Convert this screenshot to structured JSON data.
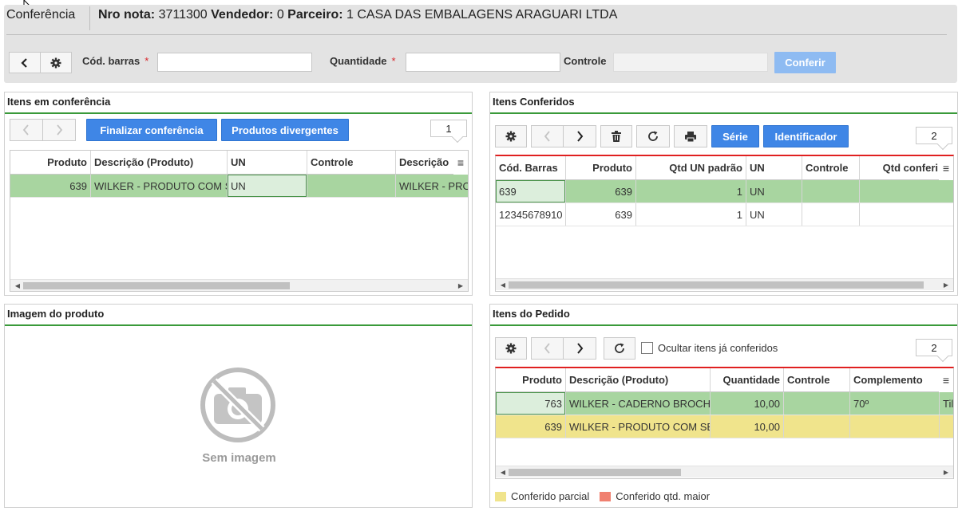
{
  "header": {
    "title": "Conferência",
    "nro_nota_label": "Nro nota:",
    "nro_nota_value": "3711300",
    "vendedor_label": "Vendedor:",
    "vendedor_value": "0",
    "parceiro_label": "Parceiro:",
    "parceiro_value": "1 CASA DAS EMBALAGENS ARAGUARI LTDA"
  },
  "toolbar": {
    "cod_barras_label": "Cód. barras",
    "quantidade_label": "Quantidade",
    "controle_label": "Controle",
    "required_mark": "*",
    "conferir_label": "Conferir",
    "cod_barras_value": "",
    "quantidade_value": "",
    "controle_value": ""
  },
  "itens_conferencia": {
    "title": "Itens em conferência",
    "finalizar_label": "Finalizar conferência",
    "divergentes_label": "Produtos divergentes",
    "page": "1",
    "columns": [
      "Produto",
      "Descrição (Produto)",
      "UN",
      "Controle",
      "Descrição"
    ],
    "rows": [
      [
        "639",
        "WILKER - PRODUTO COM SE",
        "UN",
        "",
        "WILKER - PRO"
      ]
    ]
  },
  "itens_conferidos": {
    "title": "Itens Conferidos",
    "serie_label": "Série",
    "identificador_label": "Identificador",
    "page": "2",
    "columns": [
      "Cód. Barras",
      "Produto",
      "Qtd UN padrão",
      "UN",
      "Controle",
      "Qtd conferi"
    ],
    "rows": [
      [
        "639",
        "639",
        "1",
        "UN",
        "",
        ""
      ],
      [
        "12345678910",
        "639",
        "1",
        "UN",
        "",
        ""
      ]
    ]
  },
  "imagem_produto": {
    "title": "Imagem do produto",
    "no_image_text": "Sem imagem"
  },
  "itens_pedido": {
    "title": "Itens do Pedido",
    "ocultar_label": "Ocultar itens já conferidos",
    "page": "2",
    "columns": [
      "Produto",
      "Descrição (Produto)",
      "Quantidade",
      "Controle",
      "Complemento",
      ""
    ],
    "rows": [
      [
        "763",
        "WILKER - CADERNO BROCHURA",
        "10,00",
        "",
        "70º",
        "Til"
      ],
      [
        "639",
        "WILKER - PRODUTO COM SE",
        "10,00",
        "",
        "",
        ""
      ]
    ]
  },
  "legend": {
    "parcial_label": "Conferido parcial",
    "maior_label": "Conferido qtd. maior",
    "parcial_color": "#f0e48c",
    "maior_color": "#f08070"
  }
}
